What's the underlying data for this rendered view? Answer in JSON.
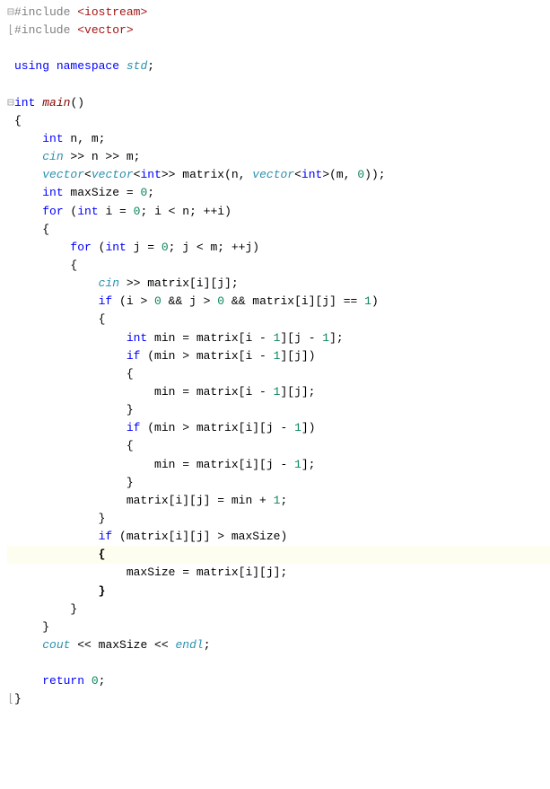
{
  "code": {
    "lines": [
      {
        "gutter": "⊟",
        "html": "<span class='pp'>#include</span> <span class='inc'>&lt;iostream&gt;</span>"
      },
      {
        "gutter": "⌊",
        "html": "<span class='pp'>#include</span> <span class='inc'>&lt;vector&gt;</span>"
      },
      {
        "gutter": "",
        "html": ""
      },
      {
        "gutter": "",
        "html": "<span class='kw'>using</span> <span class='kw'>namespace</span> <span class='type'>std</span>;"
      },
      {
        "gutter": "",
        "html": ""
      },
      {
        "gutter": "⊟",
        "html": "<span class='kw'>int</span> <span class='func'>main</span>()"
      },
      {
        "gutter": "",
        "html": "{"
      },
      {
        "gutter": "",
        "html": "    <span class='kw'>int</span> n, m;"
      },
      {
        "gutter": "",
        "html": "    <span class='type'>cin</span> &gt;&gt; n &gt;&gt; m;"
      },
      {
        "gutter": "",
        "html": "    <span class='type'>vector</span>&lt;<span class='type'>vector</span>&lt;<span class='kw'>int</span>&gt;&gt; matrix(n, <span class='type'>vector</span>&lt;<span class='kw'>int</span>&gt;(m, <span class='num'>0</span>));"
      },
      {
        "gutter": "",
        "html": "    <span class='kw'>int</span> maxSize = <span class='num'>0</span>;"
      },
      {
        "gutter": "",
        "html": "    <span class='kw'>for</span> (<span class='kw'>int</span> i = <span class='num'>0</span>; i &lt; n; ++i)"
      },
      {
        "gutter": "",
        "html": "    {"
      },
      {
        "gutter": "",
        "html": "        <span class='kw'>for</span> (<span class='kw'>int</span> j = <span class='num'>0</span>; j &lt; m; ++j)"
      },
      {
        "gutter": "",
        "html": "        {"
      },
      {
        "gutter": "",
        "html": "            <span class='type'>cin</span> &gt;&gt; matrix[i][j];"
      },
      {
        "gutter": "",
        "html": "            <span class='kw'>if</span> (i &gt; <span class='num'>0</span> &amp;&amp; j &gt; <span class='num'>0</span> &amp;&amp; matrix[i][j] == <span class='num'>1</span>)"
      },
      {
        "gutter": "",
        "html": "            {"
      },
      {
        "gutter": "",
        "html": "                <span class='kw'>int</span> min = matrix[i - <span class='num'>1</span>][j - <span class='num'>1</span>];"
      },
      {
        "gutter": "",
        "html": "                <span class='kw'>if</span> (min &gt; matrix[i - <span class='num'>1</span>][j])"
      },
      {
        "gutter": "",
        "html": "                {"
      },
      {
        "gutter": "",
        "html": "                    min = matrix[i - <span class='num'>1</span>][j];"
      },
      {
        "gutter": "",
        "html": "                }"
      },
      {
        "gutter": "",
        "html": "                <span class='kw'>if</span> (min &gt; matrix[i][j - <span class='num'>1</span>])"
      },
      {
        "gutter": "",
        "html": "                {"
      },
      {
        "gutter": "",
        "html": "                    min = matrix[i][j - <span class='num'>1</span>];"
      },
      {
        "gutter": "",
        "html": "                }"
      },
      {
        "gutter": "",
        "html": "                matrix[i][j] = min + <span class='num'>1</span>;"
      },
      {
        "gutter": "",
        "html": "            }"
      },
      {
        "gutter": "",
        "html": "            <span class='kw'>if</span> (matrix[i][j] &gt; maxSize)"
      },
      {
        "gutter": "",
        "html": "            <b>{</b>",
        "highlight": true
      },
      {
        "gutter": "",
        "html": "                maxSize = matrix[i][j];"
      },
      {
        "gutter": "",
        "html": "            <b>}</b>"
      },
      {
        "gutter": "",
        "html": "        }"
      },
      {
        "gutter": "",
        "html": "    }"
      },
      {
        "gutter": "",
        "html": "    <span class='type'>cout</span> &lt;&lt; maxSize &lt;&lt; <span class='type'>endl</span>;"
      },
      {
        "gutter": "",
        "html": ""
      },
      {
        "gutter": "",
        "html": "    <span class='kw'>return</span> <span class='num'>0</span>;"
      },
      {
        "gutter": "⌊",
        "html": "}"
      }
    ]
  }
}
